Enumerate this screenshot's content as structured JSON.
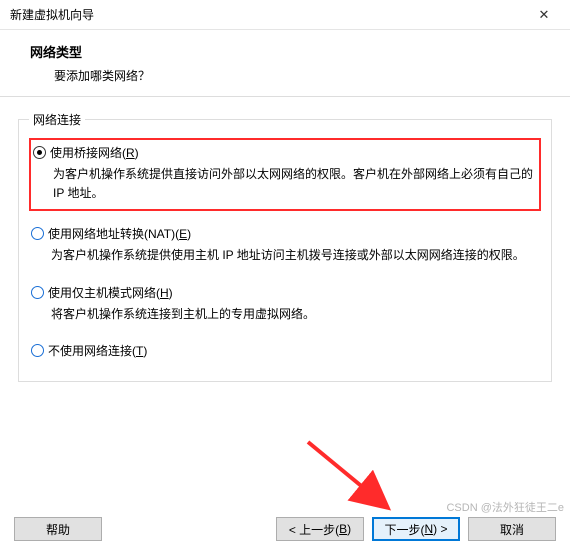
{
  "window": {
    "title": "新建虚拟机向导",
    "close_icon": "✕"
  },
  "header": {
    "heading": "网络类型",
    "sub": "要添加哪类网络？"
  },
  "group": {
    "legend": "网络连接",
    "options": [
      {
        "label_pre": "使用桥接网络(",
        "label_accel": "R",
        "label_post": ")",
        "desc": "为客户机操作系统提供直接访问外部以太网网络的权限。客户机在外部网络上必须有自己的 IP 地址。",
        "selected": true
      },
      {
        "label_pre": "使用网络地址转换(NAT)(",
        "label_accel": "E",
        "label_post": ")",
        "desc": "为客户机操作系统提供使用主机 IP 地址访问主机拨号连接或外部以太网网络连接的权限。",
        "selected": false
      },
      {
        "label_pre": "使用仅主机模式网络(",
        "label_accel": "H",
        "label_post": ")",
        "desc": "将客户机操作系统连接到主机上的专用虚拟网络。",
        "selected": false
      },
      {
        "label_pre": "不使用网络连接(",
        "label_accel": "T",
        "label_post": ")",
        "desc": "",
        "selected": false
      }
    ]
  },
  "footer": {
    "help": "帮助",
    "back_pre": "< 上一步(",
    "back_accel": "B",
    "back_post": ")",
    "next_pre": "下一步(",
    "next_accel": "N",
    "next_post": ") >",
    "cancel": "取消"
  },
  "watermark": "CSDN @法外狂徒王二e"
}
